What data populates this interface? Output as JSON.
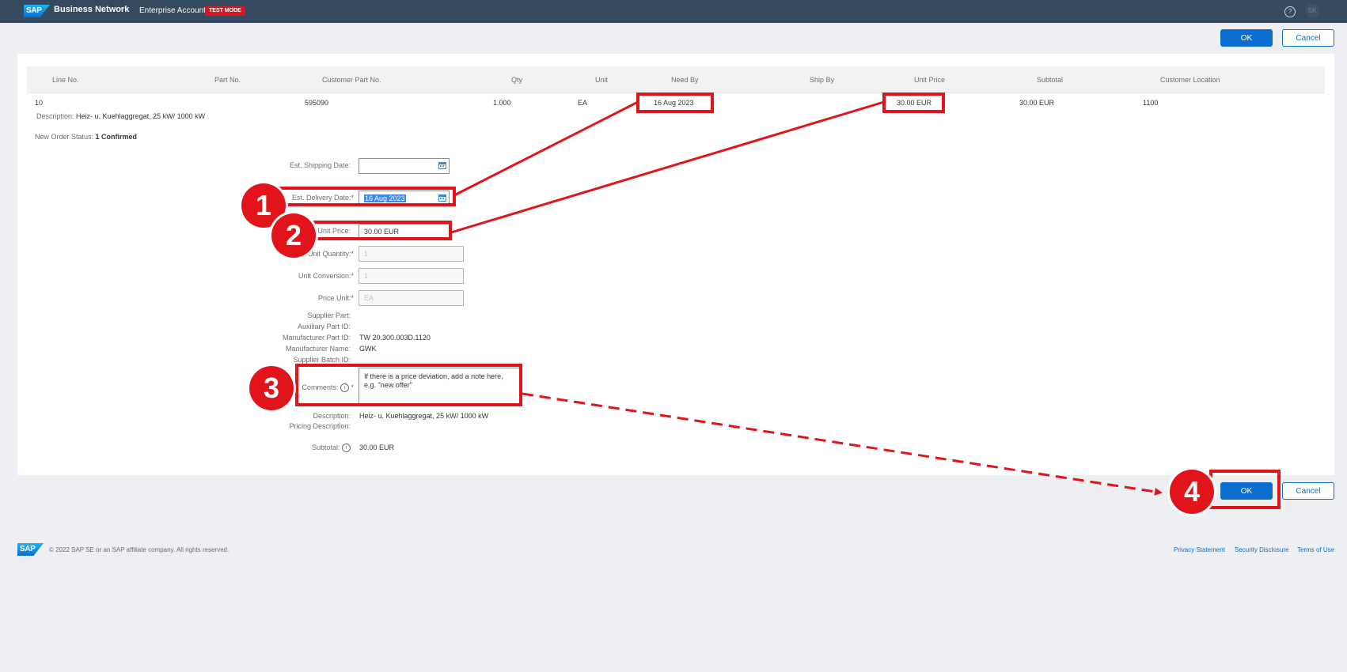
{
  "shell": {
    "logo": "SAP",
    "product": "Business Network",
    "account": "Enterprise Account",
    "badge": "TEST MODE",
    "help_icon": "question-mark-circle",
    "avatar_initials": "SK"
  },
  "actions": {
    "ok": "OK",
    "cancel": "Cancel"
  },
  "table": {
    "headers": [
      "Line No.",
      "Part No.",
      "Customer Part No.",
      "Qty",
      "Unit",
      "Need By",
      "Ship By",
      "Unit Price",
      "Subtotal",
      "Customer Location"
    ],
    "row": {
      "line_no": "10",
      "part_no": "",
      "customer_part_no": "595090",
      "qty": "1.000",
      "unit": "EA",
      "need_by": "16 Aug 2023",
      "ship_by": "",
      "unit_price": "30.00 EUR",
      "subtotal": "30.00 EUR",
      "customer_location": "1100"
    },
    "description_label": "Description:",
    "description": "Heiz- u. Kuehlaggregat, 25 kW/ 1000 kW",
    "status_label": "New Order Status:",
    "status": "1 Confirmed"
  },
  "form": {
    "est_shipping_label": "Est. Shipping Date:",
    "est_shipping_value": "",
    "est_delivery_label": "Est. Delivery Date:",
    "est_delivery_value": "16 Aug 2023",
    "unit_price_label": "Unit Price:",
    "unit_price_value": "30.00 EUR",
    "unit_quantity_label": "Unit Quantity:",
    "unit_quantity_value": "1",
    "unit_conversion_label": "Unit Conversion:",
    "unit_conversion_value": "1",
    "price_unit_label": "Price Unit:",
    "price_unit_value": "EA",
    "supplier_part_label": "Supplier Part:",
    "auxiliary_part_label": "Auxiliary Part ID:",
    "manufacturer_part_label": "Manufacturer Part ID:",
    "manufacturer_part_value": "TW 20.300.003D.1120",
    "manufacturer_name_label": "Manufacturer Name:",
    "manufacturer_name_value": "GWK",
    "supplier_batch_label": "Supplier Batch ID:",
    "comments_label": "Comments:",
    "comments_value": "If there is a price deviation, add a note here, e.g. \"new offer\"",
    "description_label": "Description:",
    "description_value": "Heiz- u. Kuehlaggregat, 25 kW/ 1000 kW",
    "pricing_description_label": "Pricing Description:",
    "subtotal_label": "Subtotal:",
    "subtotal_value": "30.00 EUR",
    "required_mark": "*"
  },
  "annotations": {
    "step1": "1",
    "step2": "2",
    "step3": "3",
    "step4": "4",
    "color": "#e1141b"
  },
  "footer": {
    "logo": "SAP",
    "copyright": "© 2022 SAP SE or an SAP affiliate company. All rights reserved.",
    "links": [
      "Privacy Statement",
      "Security Disclosure",
      "Terms of Use"
    ]
  }
}
